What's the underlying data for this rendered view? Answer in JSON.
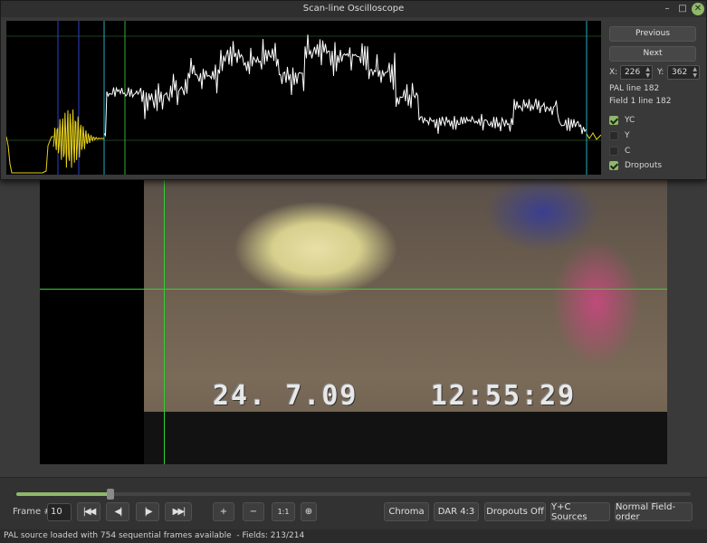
{
  "window": {
    "title": "Scan-line Oscilloscope",
    "minimize_glyph": "–",
    "maximize_glyph": "□",
    "close_glyph": "✕"
  },
  "side_panel": {
    "previous_label": "Previous",
    "next_label": "Next",
    "x_label": "X:",
    "x_value": "226",
    "y_label": "Y:",
    "y_value": "362",
    "line_info": "PAL line 182",
    "field_info": "Field 1 line 182",
    "checkboxes": [
      {
        "label": "YC",
        "checked": true
      },
      {
        "label": "Y",
        "checked": false
      },
      {
        "label": "C",
        "checked": false
      },
      {
        "label": "Dropouts",
        "checked": true
      }
    ]
  },
  "video": {
    "timestamp": "24. 7.09    12:55:29"
  },
  "controls": {
    "frame_label": "Frame #:",
    "frame_value": "10",
    "frame_progress": 0.14,
    "nav_buttons": [
      {
        "name": "first-frame-button",
        "glyph": "|◀◀"
      },
      {
        "name": "prev-frame-button",
        "glyph": "◀|"
      },
      {
        "name": "next-frame-button",
        "glyph": "|▶"
      },
      {
        "name": "last-frame-button",
        "glyph": "▶▶|"
      }
    ],
    "zoom_buttons": [
      {
        "name": "zoom-in-button",
        "glyph": "+"
      },
      {
        "name": "zoom-out-button",
        "glyph": "−"
      },
      {
        "name": "zoom-reset-button",
        "glyph": "1:1"
      },
      {
        "name": "crosshair-button",
        "glyph": "⊕"
      }
    ],
    "chroma_label": "Chroma",
    "dar_label": "DAR 4:3",
    "dropouts_label": "Dropouts Off",
    "sources_label": "Y+C Sources",
    "field_order_label": "Normal Field-order"
  },
  "status": {
    "text": "PAL source loaded with 754 sequential frames available  - Fields: 213/214"
  },
  "colors": {
    "accent": "#8fb86a",
    "trace": "#ffffff",
    "burst": "#e8d21a",
    "marker_blue": "#3040d0",
    "marker_cyan": "#20b0c0",
    "marker_green": "#30b030"
  }
}
